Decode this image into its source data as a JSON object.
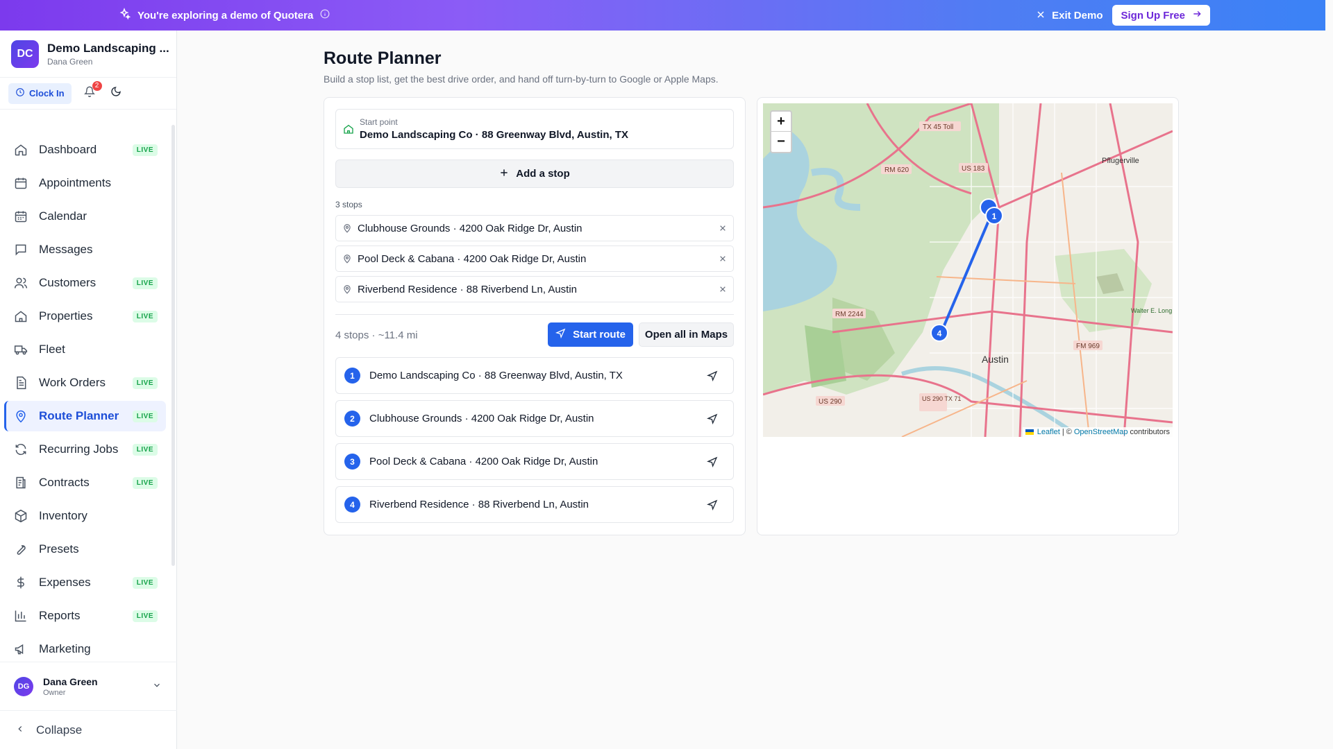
{
  "banner": {
    "message": "You're exploring a demo of Quotera",
    "exit_label": "Exit Demo",
    "signup_label": "Sign Up Free"
  },
  "org": {
    "initials": "DC",
    "name": "Demo Landscaping ...",
    "user": "Dana Green"
  },
  "quick": {
    "clock_in": "Clock In",
    "notifications": "2"
  },
  "nav": {
    "live_badge": "LIVE",
    "items": [
      {
        "label": "Dashboard",
        "icon": "home-icon",
        "live": true
      },
      {
        "label": "Appointments",
        "icon": "calendar-check-icon",
        "live": false
      },
      {
        "label": "Calendar",
        "icon": "calendar-icon",
        "live": false
      },
      {
        "label": "Messages",
        "icon": "message-icon",
        "live": false
      },
      {
        "label": "Customers",
        "icon": "users-icon",
        "live": true
      },
      {
        "label": "Properties",
        "icon": "building-icon",
        "live": true
      },
      {
        "label": "Fleet",
        "icon": "truck-icon",
        "live": false
      },
      {
        "label": "Work Orders",
        "icon": "document-icon",
        "live": true
      },
      {
        "label": "Route Planner",
        "icon": "map-pin-icon",
        "live": true,
        "active": true
      },
      {
        "label": "Recurring Jobs",
        "icon": "refresh-icon",
        "live": true
      },
      {
        "label": "Contracts",
        "icon": "contract-icon",
        "live": true
      },
      {
        "label": "Inventory",
        "icon": "box-icon",
        "live": false
      },
      {
        "label": "Presets",
        "icon": "wrench-icon",
        "live": false
      },
      {
        "label": "Expenses",
        "icon": "dollar-icon",
        "live": true
      },
      {
        "label": "Reports",
        "icon": "bar-chart-icon",
        "live": true
      },
      {
        "label": "Marketing",
        "icon": "megaphone-icon",
        "live": false
      }
    ]
  },
  "user": {
    "initials": "DG",
    "name": "Dana Green",
    "role": "Owner"
  },
  "collapse_label": "Collapse",
  "page": {
    "title": "Route Planner",
    "subtitle": "Build a stop list, get the best drive order, and hand off turn-by-turn to Google or Apple Maps."
  },
  "start_point": {
    "label": "Start point",
    "value": "Demo Landscaping Co · 88 Greenway Blvd, Austin, TX"
  },
  "add_stop_label": "Add a stop",
  "stops_count": "3 stops",
  "stops": [
    "Clubhouse Grounds · 4200 Oak Ridge Dr, Austin",
    "Pool Deck & Cabana · 4200 Oak Ridge Dr, Austin",
    "Riverbend Residence · 88 Riverbend Ln, Austin"
  ],
  "summary": "4 stops · ~11.4 mi",
  "start_route_label": "Start route",
  "open_maps_label": "Open all in Maps",
  "route": [
    {
      "num": "1",
      "label": "Demo Landscaping Co · 88 Greenway Blvd, Austin, TX"
    },
    {
      "num": "2",
      "label": "Clubhouse Grounds · 4200 Oak Ridge Dr, Austin"
    },
    {
      "num": "3",
      "label": "Pool Deck & Cabana · 4200 Oak Ridge Dr, Austin"
    },
    {
      "num": "4",
      "label": "Riverbend Residence · 88 Riverbend Ln, Austin"
    }
  ],
  "map": {
    "zoom_in": "+",
    "zoom_out": "−",
    "labels": [
      "TX 45 Toll",
      "RM 620",
      "US 183",
      "Pflugerville",
      "RM 2244",
      "Austin",
      "US 290",
      "US 290 TX 71",
      "FM 969",
      "Walter E. Long Metropolitan Park"
    ],
    "marker_labels": [
      "1",
      "4"
    ],
    "attribution": {
      "leaflet": "Leaflet",
      "sep": "| ©",
      "osm": "OpenStreetMap",
      "contrib": "contributors"
    }
  },
  "colors": {
    "accent": "#2563eb",
    "live": "#16a34a",
    "banner_start": "#7c3aed",
    "banner_end": "#3b82f6"
  }
}
